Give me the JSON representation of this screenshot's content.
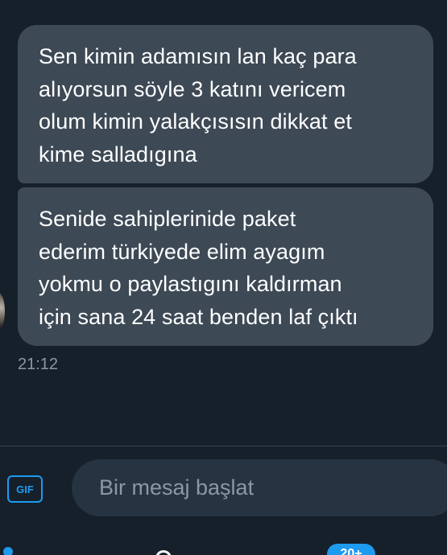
{
  "messages": [
    {
      "lines": [
        "Sen kimin adamısın lan kaç para",
        "alıyorsun söyle 3 katını vericem",
        "olum kimin yalakçısısın dikkat et",
        "kime salladıgına"
      ]
    },
    {
      "lines": [
        "Senide sahiplerinide paket",
        "ederim türkiyede elim ayagım",
        "yokmu o paylastıgını kaldırman",
        "için sana 24 saat benden laf çıktı"
      ]
    }
  ],
  "timestamp": "21:12",
  "composer": {
    "gif_label": "GIF",
    "placeholder": "Bir mesaj başlat"
  },
  "bottom_bar": {
    "badge_text": "20+"
  },
  "colors": {
    "background": "#15202b",
    "bubble": "#3d4955",
    "accent": "#1d9bf0",
    "muted_text": "#8899a6"
  }
}
